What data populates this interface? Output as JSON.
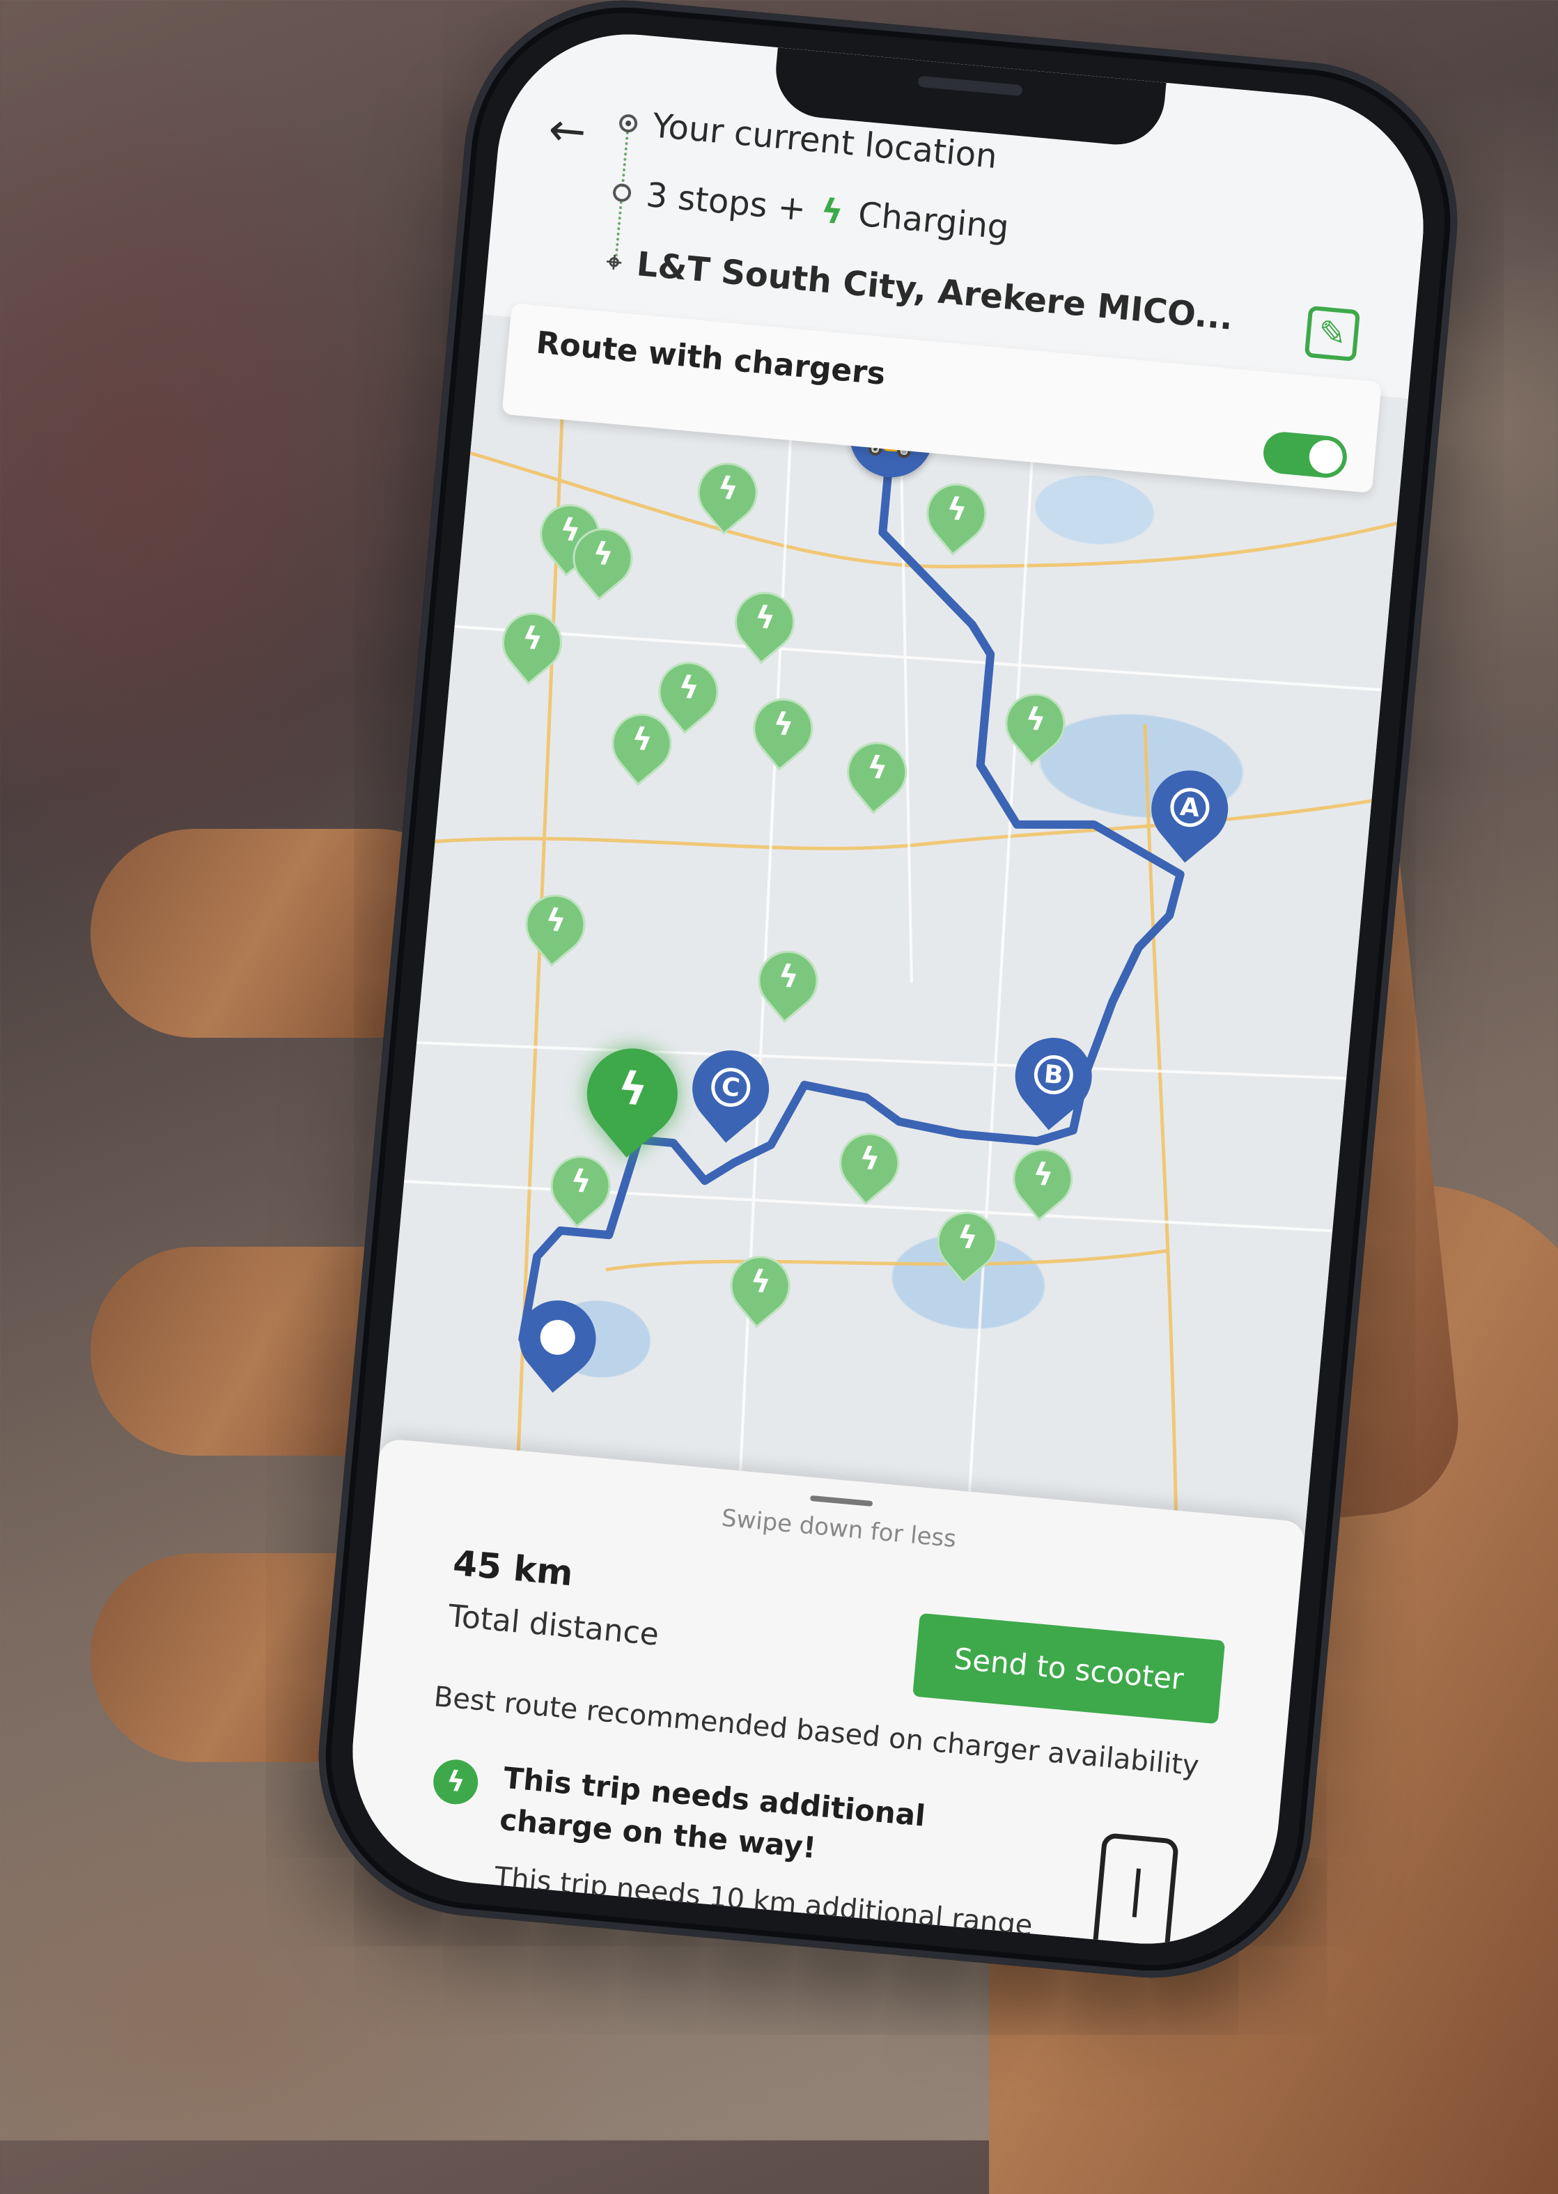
{
  "header": {
    "back_icon": "←",
    "origin": "Your current location",
    "stops_prefix": "3 stops +",
    "stops_bolt": "ϟ",
    "stops_suffix": "Charging",
    "destination": "L&T South City, Arekere MICO...",
    "edit_icon": "✎"
  },
  "route_toggle": {
    "label": "Route with chargers",
    "enabled": true
  },
  "map": {
    "expand_icon": "⤡",
    "bolt_glyph": "ϟ",
    "scooter_glyph": "🛵",
    "stops": [
      "A",
      "B",
      "C"
    ],
    "colors": {
      "route": "#3b64b4",
      "charger": "#7cc77e",
      "accent": "#3ea94a"
    }
  },
  "sheet": {
    "swipe_hint": "Swipe down for less",
    "distance": "45 km",
    "distance_label": "Total distance",
    "send_button": "Send to scooter",
    "recommendation": "Best route recommended based on charger availability",
    "alert_icon": "ϟ",
    "alert_title": "This trip needs additional charge on the way!",
    "alert_detail": "This trip needs 10 km additional range"
  }
}
